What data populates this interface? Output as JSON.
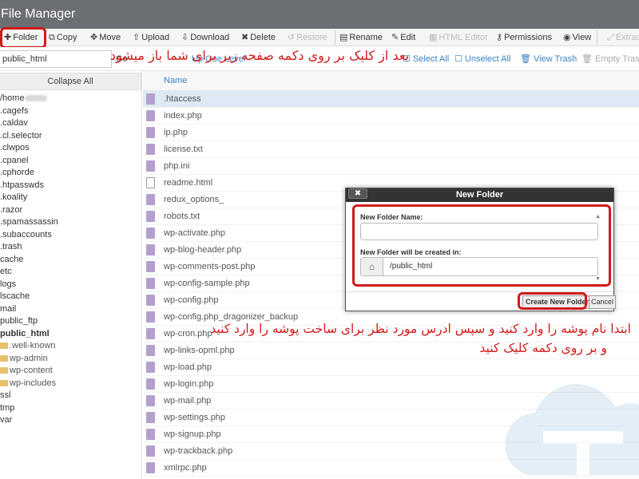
{
  "app": {
    "title": "File Manager"
  },
  "toolbar": {
    "folder": "Folder",
    "copy": "Copy",
    "move": "Move",
    "upload": "Upload",
    "download": "Download",
    "delete": "Delete",
    "restore": "Restore",
    "rename": "Rename",
    "edit": "Edit",
    "html_editor": "HTML Editor",
    "permissions": "Permissions",
    "view": "View",
    "extract": "Extract"
  },
  "toolbar2": {
    "path": "public_html",
    "go": "Go",
    "up_level": "Up One Level",
    "select_all": "Select All",
    "unselect_all": "Unselect All",
    "view_trash": "View Trash",
    "empty_trash": "Empty Trash"
  },
  "sidebar": {
    "collapse_all": "Collapse All",
    "items": [
      {
        "label": "/home"
      },
      {
        "label": ".cagefs"
      },
      {
        "label": ".caldav"
      },
      {
        "label": ".cl.selector"
      },
      {
        "label": ".clwpos"
      },
      {
        "label": ".cpanel"
      },
      {
        "label": ".cphorde"
      },
      {
        "label": ".htpasswds"
      },
      {
        "label": ".koality"
      },
      {
        "label": ".razor"
      },
      {
        "label": ".spamassassin"
      },
      {
        "label": ".subaccounts"
      },
      {
        "label": ".trash"
      },
      {
        "label": "cache"
      },
      {
        "label": "etc"
      },
      {
        "label": "logs"
      },
      {
        "label": "lscache"
      },
      {
        "label": "mail"
      },
      {
        "label": "public_ftp"
      },
      {
        "label": "public_html"
      },
      {
        "label": ".well-known"
      },
      {
        "label": "wp-admin"
      },
      {
        "label": "wp-content"
      },
      {
        "label": "wp-includes"
      },
      {
        "label": "ssl"
      },
      {
        "label": "tmp"
      },
      {
        "label": "var"
      }
    ]
  },
  "files": {
    "column_name": "Name",
    "rows": [
      {
        "name": ".htaccess"
      },
      {
        "name": "index.php"
      },
      {
        "name": "ip.php"
      },
      {
        "name": "license.txt"
      },
      {
        "name": "php.ini"
      },
      {
        "name": "readme.html"
      },
      {
        "name": "redux_options_"
      },
      {
        "name": "robots.txt"
      },
      {
        "name": "wp-activate.php"
      },
      {
        "name": "wp-blog-header.php"
      },
      {
        "name": "wp-comments-post.php"
      },
      {
        "name": "wp-config-sample.php"
      },
      {
        "name": "wp-config.php"
      },
      {
        "name": "wp-config.php_dragonizer_backup"
      },
      {
        "name": "wp-cron.php"
      },
      {
        "name": "wp-links-opml.php"
      },
      {
        "name": "wp-load.php"
      },
      {
        "name": "wp-login.php"
      },
      {
        "name": "wp-mail.php"
      },
      {
        "name": "wp-settings.php"
      },
      {
        "name": "wp-signup.php"
      },
      {
        "name": "wp-trackback.php"
      },
      {
        "name": "xmlrpc.php"
      }
    ]
  },
  "dialog": {
    "title": "New Folder",
    "close": "✖",
    "name_label": "New Folder Name:",
    "name_value": "",
    "location_label": "New Folder will be created in:",
    "location_value": "/public_html",
    "create_button": "Create New Folder",
    "cancel_button": "Cancel"
  },
  "annotations": {
    "top": "بعد از کلیک بر روی دکمه صفحه زیر برای شما باز میشود",
    "bottom_line1": "ابتدا نام پوشه را وارد کنید و سپس ادرس مورد نظر برای ساخت پوشه را وارد کنید",
    "bottom_line2": "و بر روی دکمه کلیک کنید"
  },
  "colors": {
    "highlight": "#d11a1a",
    "titlebar": "#6b6e73",
    "link": "#3a82c4",
    "selected_row": "#dde9f5"
  }
}
